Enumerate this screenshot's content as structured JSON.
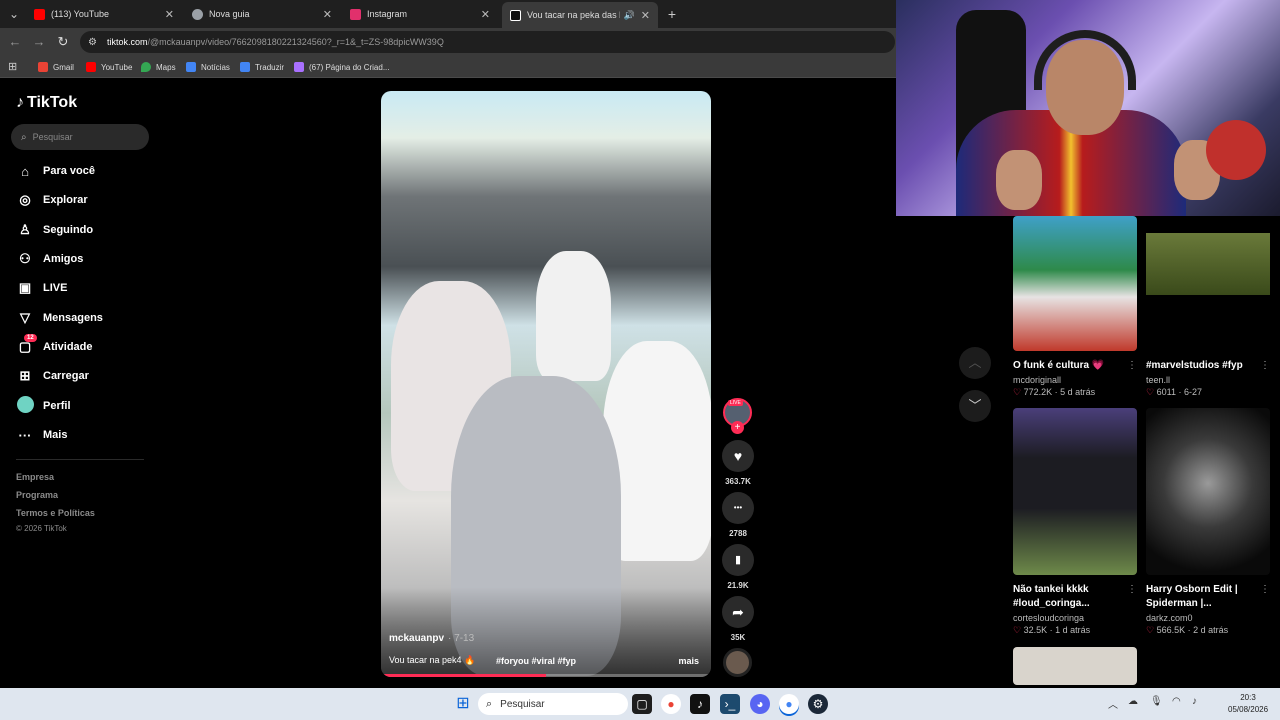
{
  "browser": {
    "tabs": [
      {
        "label": "(113) YouTube",
        "color": "#ff0000",
        "active": false
      },
      {
        "label": "Nova guia",
        "color": "#9aa0a6",
        "active": false
      },
      {
        "label": "Instagram",
        "color": "#e1306c",
        "active": false
      },
      {
        "label": "Vou tacar na peka das bb s",
        "color": "#ffffff",
        "active": true
      }
    ],
    "close_glyph": "✕",
    "new_tab_glyph": "+",
    "url_host": "tiktok.com",
    "url_path": "/@mckauanpv/video/7662098180221324560?_r=1&_t=ZS-98dpicWW39Q",
    "bookmarks": [
      {
        "label": "Gmail",
        "color": "#ea4335"
      },
      {
        "label": "YouTube",
        "color": "#ff0000"
      },
      {
        "label": "Maps",
        "color": "#34a853"
      },
      {
        "label": "Notícias",
        "color": "#4285f4"
      },
      {
        "label": "Traduzir",
        "color": "#4285f4"
      },
      {
        "label": "(67) Página do Criad...",
        "color": "#a970ff"
      }
    ]
  },
  "tiktok": {
    "logo": "TikTok",
    "search_placeholder": "Pesquisar",
    "nav": [
      {
        "label": "Para você",
        "icon": "home-icon",
        "glyph": "⌂"
      },
      {
        "label": "Explorar",
        "icon": "compass-icon",
        "glyph": "◎"
      },
      {
        "label": "Seguindo",
        "icon": "following-icon",
        "glyph": "♙"
      },
      {
        "label": "Amigos",
        "icon": "friends-icon",
        "glyph": "⚇"
      },
      {
        "label": "LIVE",
        "icon": "live-icon",
        "glyph": "▣"
      },
      {
        "label": "Mensagens",
        "icon": "messages-icon",
        "glyph": "▽"
      },
      {
        "label": "Atividade",
        "icon": "activity-icon",
        "glyph": "▢",
        "badge": "12"
      },
      {
        "label": "Carregar",
        "icon": "upload-icon",
        "glyph": "⊞"
      },
      {
        "label": "Perfil",
        "icon": "profile-avatar",
        "glyph": ""
      },
      {
        "label": "Mais",
        "icon": "more-icon",
        "glyph": "···"
      }
    ],
    "footer": [
      "Empresa",
      "Programa",
      "Termos e Políticas"
    ],
    "copyright": "© 2026 TikTok"
  },
  "video": {
    "author": "mckauanpv",
    "date": "· 7-13",
    "caption": "Vou tacar na pek4 🔥",
    "tags": "#foryou #viral #fyp",
    "more": "mais",
    "progress": 0.5,
    "live_label": "LIVE",
    "actions": [
      {
        "name": "like",
        "icon": "heart-icon",
        "glyph": "♥",
        "count": "363.7K"
      },
      {
        "name": "comment",
        "icon": "comment-icon",
        "glyph": "•••",
        "count": "2788"
      },
      {
        "name": "save",
        "icon": "bookmark-icon",
        "glyph": "▮",
        "count": "21.9K"
      },
      {
        "name": "share",
        "icon": "share-icon",
        "glyph": "➦",
        "count": "35K"
      }
    ]
  },
  "recommendations": [
    {
      "title": "O funk é cultura 💗",
      "author": "mcdoriginall",
      "likes": "772.2K",
      "age": "5 d atrás",
      "thumb": "#5a8a5a"
    },
    {
      "title": "#marvelstudios #fyp",
      "author": "teen.ll",
      "likes": "6011",
      "age": "6-27",
      "thumb": "#3a4a2a"
    },
    {
      "title": "Não tankei kkkk #loud_coringa...",
      "author": "cortesloudcoringa",
      "likes": "32.5K",
      "age": "1 d atrás",
      "thumb": "#3c3a52"
    },
    {
      "title": "Harry Osborn Edit | Spiderman |...",
      "author": "darkz.com0",
      "likes": "566.5K",
      "age": "2 d atrás",
      "thumb": "#2a2a2a"
    }
  ],
  "taskbar": {
    "search_placeholder": "Pesquisar",
    "time": "20:3",
    "date": "05/08/2026"
  }
}
